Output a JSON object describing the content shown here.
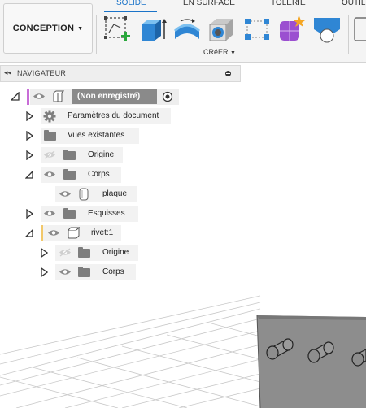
{
  "toolbar": {
    "workspace_label": "CONCEPTION",
    "tabs": [
      {
        "label": "SOLIDE"
      },
      {
        "label": "EN SURFACE"
      },
      {
        "label": "TOLERIE"
      },
      {
        "label": "OUTIL"
      }
    ],
    "group_label": "CRéER",
    "tools": [
      "sketch-icon",
      "extrude-icon",
      "revolve-icon",
      "hole-icon",
      "rectangular-pattern-icon",
      "create-form-icon",
      "shell-icon",
      "partial-tool-icon"
    ]
  },
  "navigator": {
    "title": "NAVIGATEUR",
    "root_label": "(Non enregistré)",
    "items": [
      {
        "label": "Paramètres du document"
      },
      {
        "label": "Vues existantes"
      },
      {
        "label": "Origine"
      },
      {
        "label": "Corps"
      },
      {
        "label": "plaque"
      },
      {
        "label": "Esquisses"
      },
      {
        "label": "rivet:1"
      },
      {
        "label": "Origine"
      },
      {
        "label": "Corps"
      }
    ]
  },
  "colors": {
    "accent": "#1a73c8",
    "root_bar": "#c86dd7",
    "component_bar": "#f2c86a",
    "selected_bg": "#8a8a8a"
  }
}
